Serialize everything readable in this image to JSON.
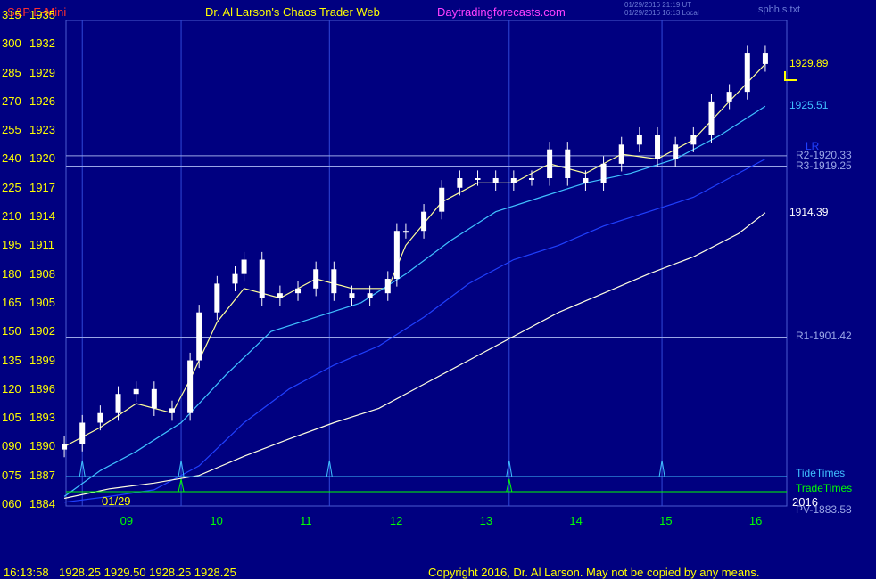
{
  "header": {
    "symbol": "S&P E-Mini",
    "title": "Dr. Al Larson's Chaos Trader Web",
    "site": "Daytradingforecasts.com",
    "timestamp_utc": "01/29/2016 21:19 UT",
    "timestamp_local": "01/29/2016 16:13 Local",
    "spb_label": "spbh.s.txt"
  },
  "colors": {
    "background": "#000080",
    "axis_label": "#ffff00",
    "time_label": "#00ff00",
    "title_red": "#ff3030",
    "site_magenta": "#ff40ff",
    "candle_up": "#ffffff",
    "candle_down": "#ffffff",
    "ma_fast": "#ffff99",
    "ma_cyan": "#40c0ff",
    "ma_blue": "#2040ff",
    "ma_white": "#ffffe0",
    "level_line": "#9aa6e6",
    "tide": "#40c0ff",
    "trade": "#00ff00"
  },
  "chart_data": {
    "type": "candlestick",
    "title": "S&P E-Mini",
    "y_left_labels": [
      "315",
      "300",
      "285",
      "270",
      "255",
      "240",
      "225",
      "210",
      "195",
      "180",
      "165",
      "150",
      "135",
      "120",
      "105",
      "090",
      "075",
      "060"
    ],
    "y_labels": [
      "1935",
      "1932",
      "1929",
      "1926",
      "1923",
      "1920",
      "1917",
      "1914",
      "1911",
      "1908",
      "1905",
      "1902",
      "1899",
      "1896",
      "1893",
      "1890",
      "1887",
      "1884"
    ],
    "ylim": [
      1884,
      1935
    ],
    "x_labels": [
      "09",
      "10",
      "11",
      "12",
      "13",
      "14",
      "15",
      "16"
    ],
    "xlim": [
      8.2,
      16.2
    ],
    "date_label": "01/29",
    "year_label": "2016",
    "time_marker_lines": [
      8.5,
      9.6,
      11.25,
      13.25,
      14.95
    ],
    "levels": [
      {
        "name": "R2-1920.33",
        "value": 1920.33
      },
      {
        "name": "R3-1919.25",
        "value": 1919.25
      },
      {
        "name": "R1-1901.42",
        "value": 1901.42
      }
    ],
    "ma_labels": [
      {
        "text": "1929.89",
        "value": 1929.89,
        "color": "#ffff00"
      },
      {
        "text": "1925.51",
        "value": 1925.51,
        "color": "#40c0ff"
      },
      {
        "text": "1914.39",
        "value": 1914.39,
        "color": "#ffffff"
      }
    ],
    "lr_label": "LR",
    "pivot_label": "PV-1883.58",
    "tide_label": "TideTimes",
    "tide_times": [
      8.5,
      9.6,
      11.25,
      13.25,
      14.95
    ],
    "trade_label": "TradeTimes",
    "trade_times": [
      9.6,
      13.25
    ],
    "series": [
      {
        "name": "close",
        "x": [
          8.3,
          8.5,
          8.7,
          8.9,
          9.1,
          9.3,
          9.5,
          9.7,
          9.8,
          10.0,
          10.2,
          10.3,
          10.5,
          10.7,
          10.9,
          11.1,
          11.3,
          11.5,
          11.7,
          11.9,
          12.0,
          12.1,
          12.3,
          12.5,
          12.7,
          12.9,
          13.1,
          13.3,
          13.5,
          13.7,
          13.9,
          14.1,
          14.3,
          14.5,
          14.7,
          14.9,
          15.1,
          15.3,
          15.5,
          15.7,
          15.9,
          16.1
        ],
        "y": [
          1890.3,
          1892.5,
          1893.5,
          1895.5,
          1896.0,
          1894.0,
          1893.5,
          1899.0,
          1904.0,
          1907.0,
          1908.0,
          1909.5,
          1905.5,
          1906.0,
          1906.5,
          1908.5,
          1906.0,
          1905.5,
          1906.0,
          1907.5,
          1912.5,
          1912.5,
          1914.5,
          1917.0,
          1918.0,
          1918.0,
          1917.5,
          1918.0,
          1918.0,
          1921.0,
          1918.0,
          1917.5,
          1919.5,
          1921.5,
          1922.5,
          1920.0,
          1921.5,
          1922.5,
          1926.0,
          1927.0,
          1931.0,
          1929.9
        ]
      },
      {
        "name": "ma_fast",
        "x": [
          8.3,
          8.7,
          9.1,
          9.5,
          9.7,
          10.0,
          10.3,
          10.7,
          11.1,
          11.5,
          11.9,
          12.1,
          12.5,
          12.9,
          13.3,
          13.7,
          14.1,
          14.5,
          14.9,
          15.3,
          15.7,
          16.1
        ],
        "y": [
          1890.0,
          1892.0,
          1894.5,
          1893.5,
          1897.0,
          1903.0,
          1906.5,
          1905.5,
          1907.5,
          1906.5,
          1906.5,
          1911.0,
          1915.5,
          1917.5,
          1917.5,
          1919.5,
          1918.5,
          1920.5,
          1920.0,
          1922.0,
          1926.0,
          1929.9
        ]
      },
      {
        "name": "ma_cyan",
        "x": [
          8.3,
          8.7,
          9.1,
          9.6,
          10.1,
          10.6,
          11.1,
          11.6,
          12.1,
          12.6,
          13.1,
          13.6,
          14.1,
          14.6,
          15.1,
          15.6,
          16.1
        ],
        "y": [
          1884.8,
          1887.5,
          1889.5,
          1892.5,
          1897.5,
          1902.0,
          1903.5,
          1905.0,
          1908.0,
          1911.5,
          1914.5,
          1916.0,
          1917.5,
          1918.5,
          1920.0,
          1922.5,
          1925.5
        ]
      },
      {
        "name": "ma_blue",
        "x": [
          8.3,
          8.8,
          9.3,
          9.8,
          10.3,
          10.8,
          11.3,
          11.8,
          12.3,
          12.8,
          13.3,
          13.8,
          14.3,
          14.8,
          15.3,
          15.8,
          16.1
        ],
        "y": [
          1884.2,
          1884.8,
          1885.5,
          1888.0,
          1892.5,
          1896.0,
          1898.5,
          1900.5,
          1903.5,
          1907.0,
          1909.5,
          1911.0,
          1913.0,
          1914.5,
          1916.0,
          1918.5,
          1920.0
        ]
      },
      {
        "name": "ma_white",
        "x": [
          8.3,
          8.8,
          9.3,
          9.8,
          10.3,
          10.8,
          11.3,
          11.8,
          12.3,
          12.8,
          13.3,
          13.8,
          14.3,
          14.8,
          15.3,
          15.8,
          16.1
        ],
        "y": [
          1884.6,
          1885.6,
          1886.2,
          1887.0,
          1889.0,
          1890.8,
          1892.5,
          1894.0,
          1896.5,
          1899.0,
          1901.5,
          1904.0,
          1906.0,
          1908.0,
          1909.8,
          1912.2,
          1914.4
        ]
      }
    ]
  },
  "footer": {
    "time": "16:13:58",
    "ohlc": "1928.25 1929.50 1928.25 1928.25",
    "copyright": "Copyright 2016, Dr. Al Larson. May not be copied by any means."
  }
}
